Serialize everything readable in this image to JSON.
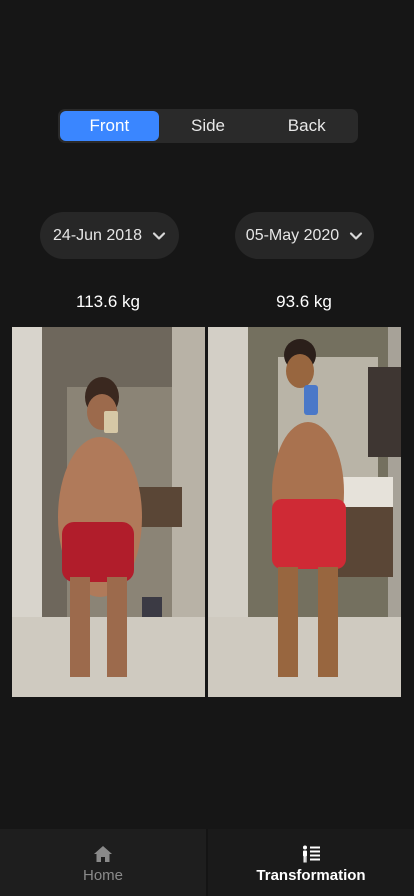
{
  "view_toggle": {
    "options": [
      "Front",
      "Side",
      "Back"
    ],
    "selected": "Front"
  },
  "comparison": {
    "left": {
      "date": "24-Jun 2018",
      "weight": "113.6 kg"
    },
    "right": {
      "date": "05-May 2020",
      "weight": "93.6 kg"
    }
  },
  "tab_bar": {
    "home_label": "Home",
    "transformation_label": "Transformation",
    "active": "Transformation"
  },
  "colors": {
    "accent": "#3a86ff",
    "background": "#161616"
  }
}
